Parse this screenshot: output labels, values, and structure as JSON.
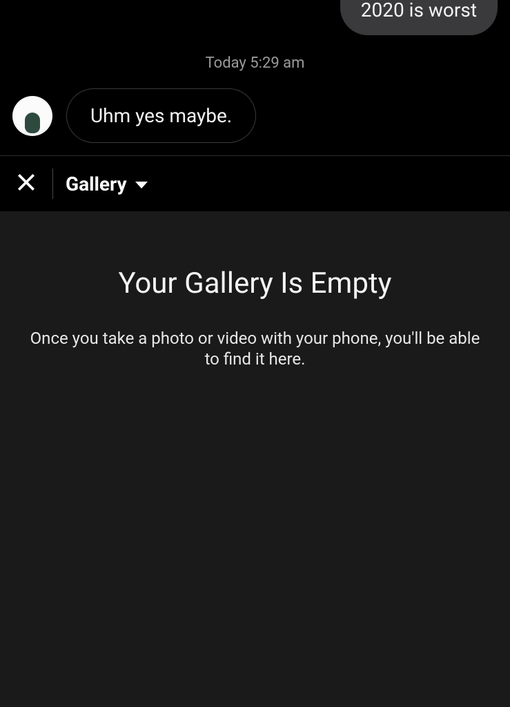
{
  "chat": {
    "outgoing_message": "2020 is worst",
    "timestamp": "Today 5:29 am",
    "incoming_message": "Uhm yes maybe."
  },
  "gallery": {
    "selector_label": "Gallery",
    "empty_title": "Your Gallery Is Empty",
    "empty_subtitle": "Once you take a photo or video with your phone, you'll be able to find it here."
  }
}
